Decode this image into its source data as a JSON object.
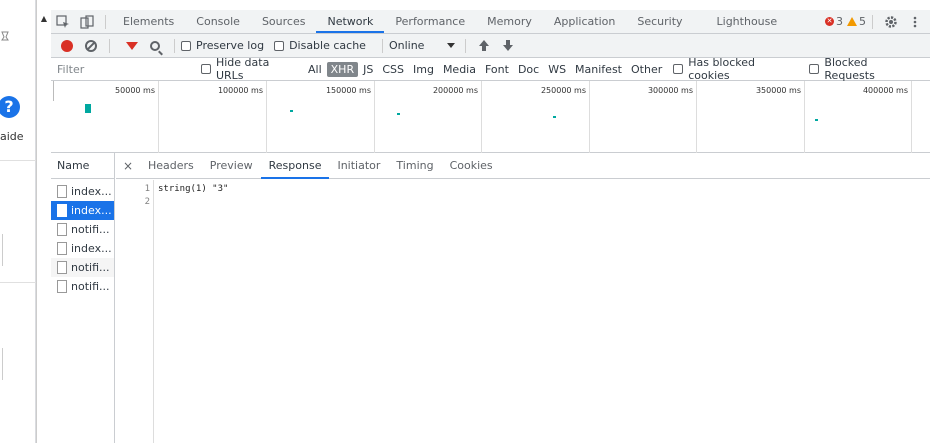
{
  "page": {
    "help_icon": "?",
    "aside_text": "aide"
  },
  "tabs": [
    {
      "label": "Elements"
    },
    {
      "label": "Console"
    },
    {
      "label": "Sources"
    },
    {
      "label": "Network"
    },
    {
      "label": "Performance"
    },
    {
      "label": "Memory"
    },
    {
      "label": "Application"
    },
    {
      "label": "Security"
    },
    {
      "label": "Lighthouse"
    }
  ],
  "status": {
    "errors": "3",
    "warnings": "5"
  },
  "toolbar": {
    "preserve_log": "Preserve log",
    "disable_cache": "Disable cache",
    "throttle": "Online"
  },
  "filter": {
    "placeholder": "Filter",
    "hide_data_urls": "Hide data URLs",
    "types": [
      "All",
      "XHR",
      "JS",
      "CSS",
      "Img",
      "Media",
      "Font",
      "Doc",
      "WS",
      "Manifest",
      "Other"
    ],
    "has_blocked_cookies": "Has blocked cookies",
    "blocked_requests": "Blocked Requests"
  },
  "overview": {
    "ticks": [
      "50000 ms",
      "100000 ms",
      "150000 ms",
      "200000 ms",
      "250000 ms",
      "300000 ms",
      "350000 ms",
      "400000 ms"
    ]
  },
  "requests": {
    "header": "Name",
    "items": [
      {
        "label": "index..."
      },
      {
        "label": "index..."
      },
      {
        "label": "notifi..."
      },
      {
        "label": "index..."
      },
      {
        "label": "notifi..."
      },
      {
        "label": "notifi..."
      }
    ]
  },
  "detail": {
    "close": "×",
    "tabs": [
      "Headers",
      "Preview",
      "Response",
      "Initiator",
      "Timing",
      "Cookies"
    ]
  },
  "response": {
    "lines": [
      {
        "num": "1",
        "text": "string(1) \"3\""
      },
      {
        "num": "2",
        "text": ""
      }
    ]
  }
}
